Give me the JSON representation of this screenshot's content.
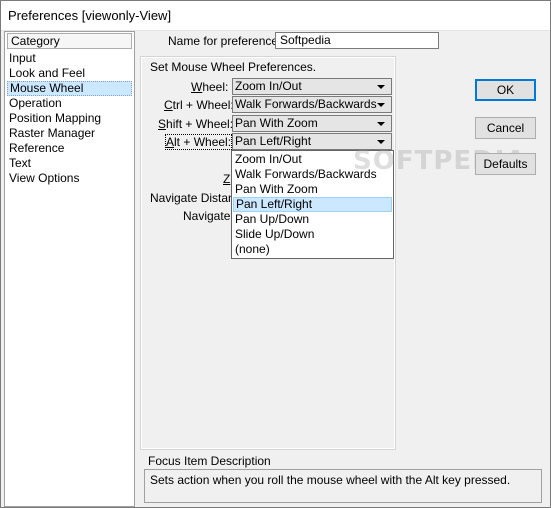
{
  "window": {
    "title": "Preferences [viewonly-View]"
  },
  "categories": {
    "header": "Category",
    "items": [
      "Input",
      "Look and Feel",
      "Mouse Wheel",
      "Operation",
      "Position Mapping",
      "Raster Manager",
      "Reference",
      "Text",
      "View Options"
    ],
    "selected": "Mouse Wheel"
  },
  "form": {
    "name_label": "Name for preferences",
    "name_value": "Softpedia",
    "section_label": "Set Mouse Wheel Preferences.",
    "wheel": {
      "key": "W",
      "rest": "heel:",
      "value": "Zoom In/Out"
    },
    "ctrl_wheel": {
      "key": "C",
      "rest": "trl + Wheel:",
      "value": "Walk Forwards/Backwards"
    },
    "shift_wheel": {
      "key": "S",
      "rest": "hift + Wheel:",
      "value": "Pan With Zoom"
    },
    "alt_wheel": {
      "key": "A",
      "rest": "lt + Wheel:",
      "value": "Pan Left/Right"
    },
    "partial_label_z": "Z",
    "navigate_distance_label": "Navigate Distanc",
    "navigate_label": "Navigate"
  },
  "dropdown": {
    "options": [
      "Zoom In/Out",
      "Walk Forwards/Backwards",
      "Pan With Zoom",
      "Pan Left/Right",
      "Pan Up/Down",
      "Slide Up/Down",
      "(none)"
    ],
    "highlighted": "Pan Left/Right"
  },
  "buttons": {
    "ok": "OK",
    "cancel": "Cancel",
    "defaults": "Defaults"
  },
  "focus": {
    "title": "Focus Item Description",
    "description": "Sets action when you roll the mouse wheel with the Alt key pressed."
  },
  "watermark": "SOFTPEDIA",
  "colors": {
    "selection": "#cce8ff",
    "default_button_border": "#0078d7"
  }
}
